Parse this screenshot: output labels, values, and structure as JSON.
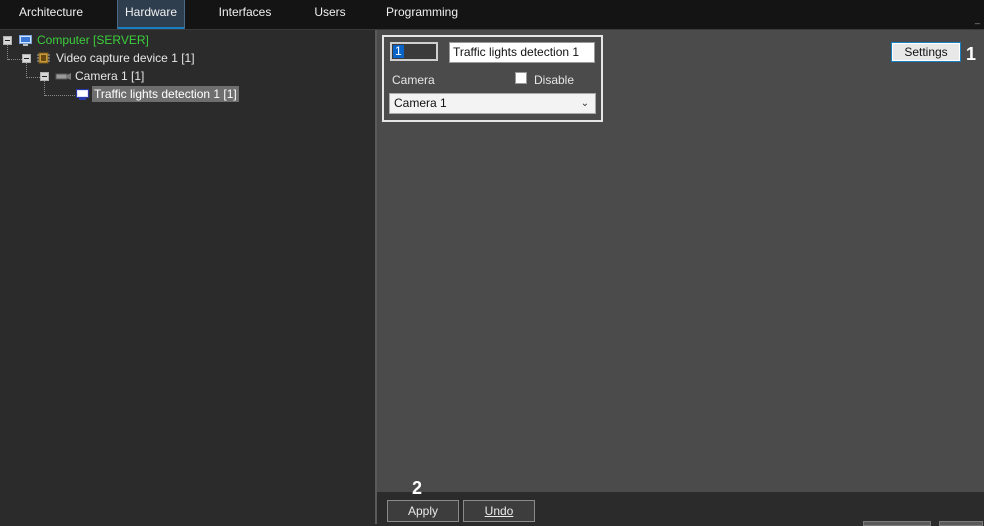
{
  "tabs": [
    {
      "label": "Architecture",
      "active": false
    },
    {
      "label": "Hardware",
      "active": true
    },
    {
      "label": "Interfaces",
      "active": false
    },
    {
      "label": "Users",
      "active": false
    },
    {
      "label": "Programming",
      "active": false
    }
  ],
  "tree": {
    "computer": {
      "label": "Computer [SERVER]",
      "color": "#3ccf3c",
      "icon": "monitor-icon"
    },
    "video_device": {
      "label": "Video capture device 1 [1]",
      "icon": "chip-icon"
    },
    "camera": {
      "label": "Camera 1 [1]",
      "icon": "camera-icon"
    },
    "detector": {
      "label": "Traffic lights detection 1 [1]",
      "icon": "monitor-icon",
      "selected": true
    }
  },
  "props": {
    "id_value": "1",
    "name_value": "Traffic lights detection 1",
    "camera_label": "Camera",
    "disable_label": "Disable",
    "disable_checked": false,
    "camera_selected": "Camera 1"
  },
  "settings_label": "Settings",
  "markers": {
    "one": "1",
    "two": "2"
  },
  "footer": {
    "apply_label": "Apply",
    "undo_label": "Undo"
  },
  "colors": {
    "accent": "#1a7fc0",
    "tree_selected_bg": "#6e6e6e",
    "panel_bg": "#4b4b4b"
  }
}
